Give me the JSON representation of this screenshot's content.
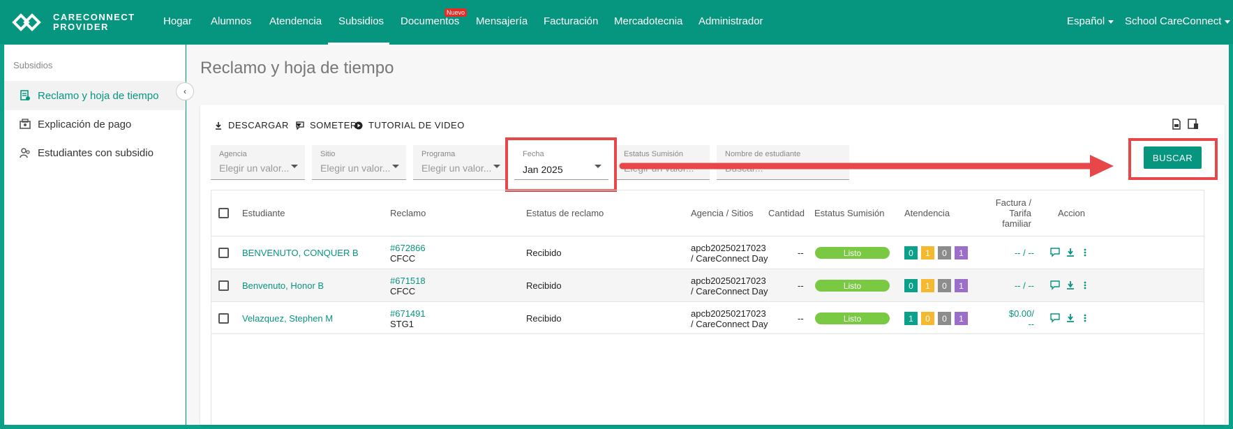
{
  "brand": {
    "line1": "CARECONNECT",
    "line2": "PROVIDER"
  },
  "nav": {
    "items": [
      "Hogar",
      "Alumnos",
      "Atendencia",
      "Subsidios",
      "Documentos",
      "Mensajería",
      "Facturación",
      "Mercadotecnia",
      "Administrador"
    ],
    "badge": "Nuevo",
    "language": "Español",
    "school": "School CareConnect"
  },
  "sidebar": {
    "title": "Subsidios",
    "items": [
      "Reclamo y hoja de tiempo",
      "Explicación de pago",
      "Estudiantes con subsidio"
    ]
  },
  "page": {
    "title": "Reclamo y hoja de tiempo"
  },
  "toolbar": {
    "download": "DESCARGAR",
    "submit": "SOMETER",
    "tutorial": "TUTORIAL DE VIDEO"
  },
  "filters": {
    "agencia": {
      "label": "Agencia",
      "value": "Elegir un valor..."
    },
    "sitio": {
      "label": "Sitio",
      "value": "Elegir un valor..."
    },
    "programa": {
      "label": "Programa",
      "value": "Elegir un valor..."
    },
    "fecha": {
      "label": "Fecha",
      "value": "Jan 2025"
    },
    "estatus": {
      "label": "Estatus Sumisión",
      "value": "Elegir un valor..."
    },
    "nombre": {
      "label": "Nombre de estudiante",
      "value": "Buscar..."
    },
    "search_button": "BUSCAR"
  },
  "table": {
    "headers": {
      "estudiante": "Estudiante",
      "reclamo": "Reclamo",
      "estatus_reclamo": "Estatus de reclamo",
      "agencia": "Agencia / Sitios",
      "cantidad": "Cantidad",
      "estatus_sumision": "Estatus Sumisión",
      "atendencia": "Atendencia",
      "factura1": "Factura /",
      "factura2": "Tarifa",
      "factura3": "familiar",
      "accion": "Accion"
    },
    "rows": [
      {
        "student": "BENVENUTO, CONQUER B",
        "claim_id": "#672866",
        "claim_code": "CFCC",
        "claim_status": "Recibido",
        "agency1": "apcb20250217023",
        "agency2": "/ CareConnect Day",
        "amount": "--",
        "submission": "Listo",
        "att": [
          "0",
          "1",
          "0",
          "1"
        ],
        "invoice1": "-- / --",
        "invoice2": ""
      },
      {
        "student": "Benvenuto, Honor B",
        "claim_id": "#671518",
        "claim_code": "CFCC",
        "claim_status": "Recibido",
        "agency1": "apcb20250217023",
        "agency2": "/ CareConnect Day",
        "amount": "--",
        "submission": "Listo",
        "att": [
          "0",
          "1",
          "0",
          "1"
        ],
        "invoice1": "-- / --",
        "invoice2": ""
      },
      {
        "student": "Velazquez, Stephen M",
        "claim_id": "#671491",
        "claim_code": "STG1",
        "claim_status": "Recibido",
        "agency1": "apcb20250217023",
        "agency2": "/ CareConnect Day",
        "amount": "--",
        "submission": "Listo",
        "att": [
          "1",
          "0",
          "0",
          "1"
        ],
        "invoice1": "$0.00/",
        "invoice2": "--"
      }
    ]
  },
  "colors": {
    "brand": "#06957f",
    "highlight": "#e8474a",
    "ready": "#7ac943",
    "att_green": "#0aa08a",
    "att_yellow": "#f5b82e",
    "att_gray": "#8c8c8c",
    "att_purple": "#9b6fc9"
  },
  "icons": [
    "logo-icon",
    "claim-doc-icon",
    "payment-icon",
    "students-icon",
    "download-icon",
    "comment-icon",
    "play-icon",
    "pdf-icon",
    "mobile-doc-icon",
    "chevron-left-icon",
    "more-vert-icon"
  ]
}
